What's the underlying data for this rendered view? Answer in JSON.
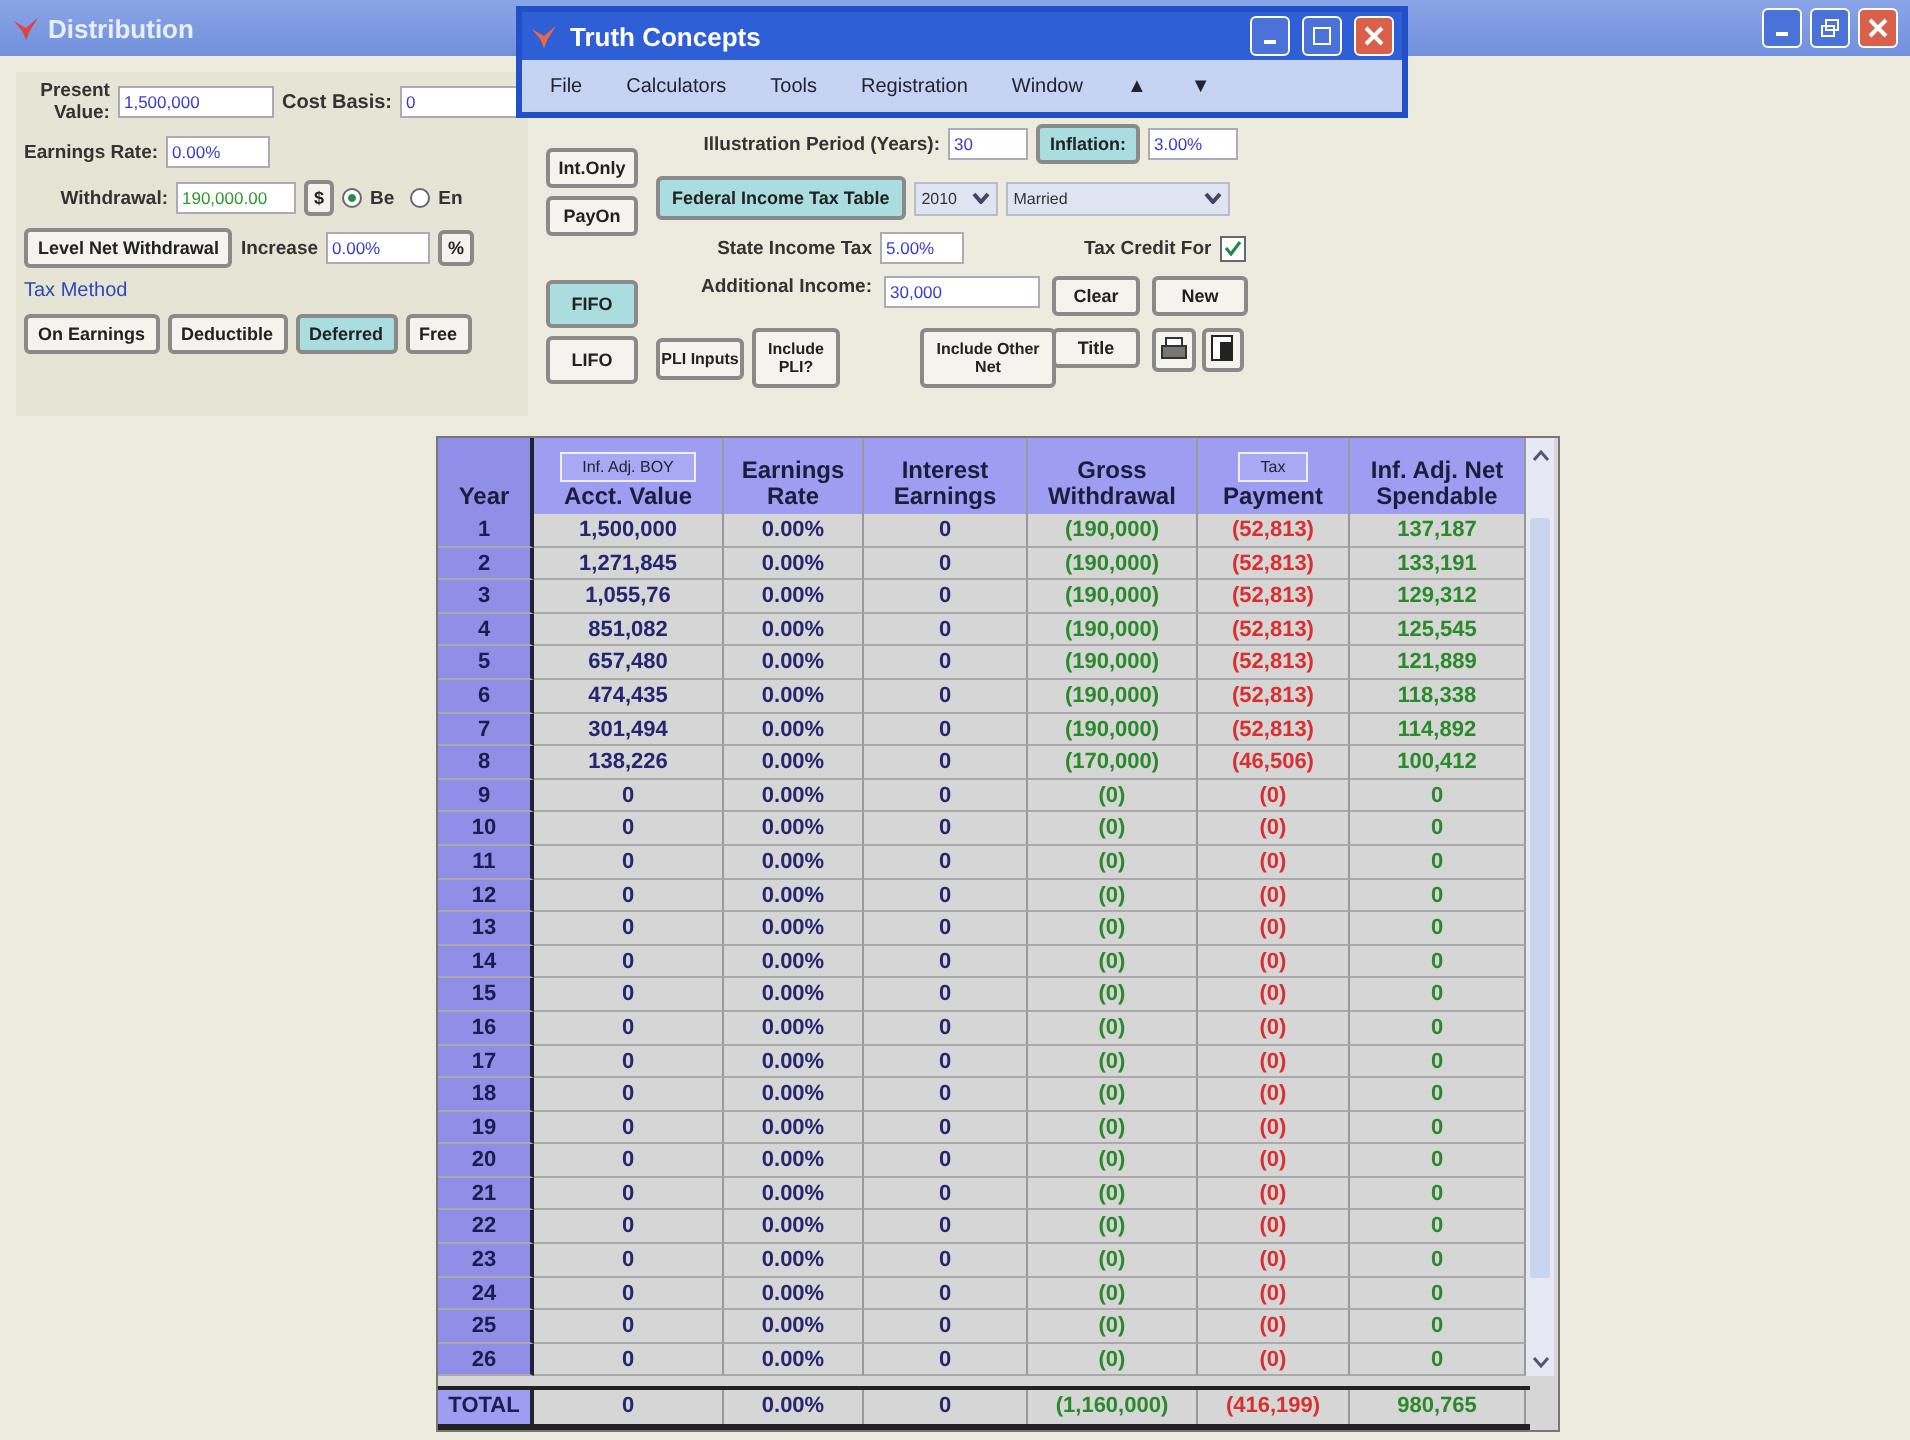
{
  "window": {
    "title": "Distribution"
  },
  "dialog": {
    "title": "Truth Concepts",
    "menu": [
      "File",
      "Calculators",
      "Tools",
      "Registration",
      "Window",
      "▲",
      "▼"
    ]
  },
  "left": {
    "present_value": {
      "label": "Present Value:",
      "value": "1,500,000"
    },
    "cost_basis": {
      "label": "Cost Basis:",
      "value": "0"
    },
    "earnings_rate": {
      "label": "Earnings Rate:",
      "value": "0.00%"
    },
    "withdrawal": {
      "label": "Withdrawal:",
      "value": "190,000.00",
      "unit": "$"
    },
    "timing": [
      {
        "label": "Be",
        "selected": true
      },
      {
        "label": "En",
        "selected": false
      }
    ],
    "level_button": "Level Net Withdrawal",
    "increase": {
      "label": "Increase",
      "value": "0.00%",
      "unit": "%"
    },
    "tax_method": {
      "label": "Tax Method",
      "options": [
        {
          "label": "On Earnings",
          "selected": false
        },
        {
          "label": "Deductible",
          "selected": false
        },
        {
          "label": "Deferred",
          "selected": true
        },
        {
          "label": "Free",
          "selected": false
        }
      ]
    }
  },
  "middle": {
    "buttons": [
      "Int.Only",
      "PayOn"
    ],
    "order": [
      {
        "label": "FIFO",
        "selected": true
      },
      {
        "label": "LIFO",
        "selected": false
      }
    ]
  },
  "right": {
    "illustration_period": {
      "label": "Illustration Period (Years):",
      "value": "30"
    },
    "inflation": {
      "label": "Inflation:",
      "highlighted": true,
      "value": "3.00%"
    },
    "federal_tax": {
      "label": "Federal Income Tax Table",
      "highlighted": true,
      "year": "2010",
      "status": "Married"
    },
    "state_tax": {
      "label": "State Income Tax",
      "value": "5.00%"
    },
    "tax_credit": {
      "label": "Tax Credit For",
      "checked": true
    },
    "additional_income": {
      "label": "Additional Income:",
      "value": "30,000"
    },
    "pli_inputs": "PLI Inputs",
    "include_pli": "Include PLI?",
    "include_other": "Include Other Net",
    "clear": "Clear",
    "new": "New",
    "title_button": "Title"
  },
  "table": {
    "columns": [
      {
        "label": "Year",
        "kind": "index"
      },
      {
        "label": "Acct. Value",
        "button": "Inf. Adj. BOY",
        "kind": "plain"
      },
      {
        "label": "Earnings Rate",
        "kind": "plain"
      },
      {
        "label": "Interest Earnings",
        "kind": "plain"
      },
      {
        "label": "Gross Withdrawal",
        "kind": "positive"
      },
      {
        "label": "Payment",
        "button": "Tax",
        "kind": "negative"
      },
      {
        "label": "Inf. Adj. Net Spendable",
        "kind": "positive"
      }
    ],
    "rows": [
      [
        "1",
        "1,500,000",
        "0.00%",
        "0",
        "(190,000)",
        "(52,813)",
        "137,187"
      ],
      [
        "2",
        "1,271,845",
        "0.00%",
        "0",
        "(190,000)",
        "(52,813)",
        "133,191"
      ],
      [
        "3",
        "1,055,76",
        "0.00%",
        "0",
        "(190,000)",
        "(52,813)",
        "129,312"
      ],
      [
        "4",
        "851,082",
        "0.00%",
        "0",
        "(190,000)",
        "(52,813)",
        "125,545"
      ],
      [
        "5",
        "657,480",
        "0.00%",
        "0",
        "(190,000)",
        "(52,813)",
        "121,889"
      ],
      [
        "6",
        "474,435",
        "0.00%",
        "0",
        "(190,000)",
        "(52,813)",
        "118,338"
      ],
      [
        "7",
        "301,494",
        "0.00%",
        "0",
        "(190,000)",
        "(52,813)",
        "114,892"
      ],
      [
        "8",
        "138,226",
        "0.00%",
        "0",
        "(170,000)",
        "(46,506)",
        "100,412"
      ],
      [
        "9",
        "0",
        "0.00%",
        "0",
        "(0)",
        "(0)",
        "0"
      ],
      [
        "10",
        "0",
        "0.00%",
        "0",
        "(0)",
        "(0)",
        "0"
      ],
      [
        "11",
        "0",
        "0.00%",
        "0",
        "(0)",
        "(0)",
        "0"
      ],
      [
        "12",
        "0",
        "0.00%",
        "0",
        "(0)",
        "(0)",
        "0"
      ],
      [
        "13",
        "0",
        "0.00%",
        "0",
        "(0)",
        "(0)",
        "0"
      ],
      [
        "14",
        "0",
        "0.00%",
        "0",
        "(0)",
        "(0)",
        "0"
      ],
      [
        "15",
        "0",
        "0.00%",
        "0",
        "(0)",
        "(0)",
        "0"
      ],
      [
        "16",
        "0",
        "0.00%",
        "0",
        "(0)",
        "(0)",
        "0"
      ],
      [
        "17",
        "0",
        "0.00%",
        "0",
        "(0)",
        "(0)",
        "0"
      ],
      [
        "18",
        "0",
        "0.00%",
        "0",
        "(0)",
        "(0)",
        "0"
      ],
      [
        "19",
        "0",
        "0.00%",
        "0",
        "(0)",
        "(0)",
        "0"
      ],
      [
        "20",
        "0",
        "0.00%",
        "0",
        "(0)",
        "(0)",
        "0"
      ],
      [
        "21",
        "0",
        "0.00%",
        "0",
        "(0)",
        "(0)",
        "0"
      ],
      [
        "22",
        "0",
        "0.00%",
        "0",
        "(0)",
        "(0)",
        "0"
      ],
      [
        "23",
        "0",
        "0.00%",
        "0",
        "(0)",
        "(0)",
        "0"
      ],
      [
        "24",
        "0",
        "0.00%",
        "0",
        "(0)",
        "(0)",
        "0"
      ],
      [
        "25",
        "0",
        "0.00%",
        "0",
        "(0)",
        "(0)",
        "0"
      ],
      [
        "26",
        "0",
        "0.00%",
        "0",
        "(0)",
        "(0)",
        "0"
      ]
    ],
    "total": [
      "TOTAL",
      "0",
      "0.00%",
      "0",
      "(1,160,000)",
      "(416,199)",
      "980,765"
    ]
  }
}
